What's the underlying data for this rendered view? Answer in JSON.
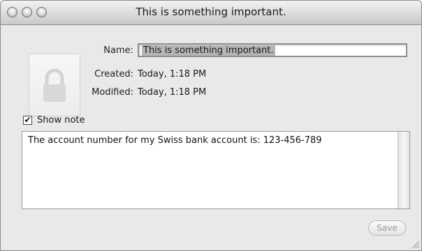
{
  "window": {
    "title": "This is something important."
  },
  "info": {
    "name_label": "Name:",
    "name_value": "This is something important.",
    "created_label": "Created:",
    "created_value": "Today, 1:18 PM",
    "modified_label": "Modified:",
    "modified_value": "Today, 1:18 PM"
  },
  "note": {
    "show_note_label": "Show note",
    "show_note_checked": true,
    "text": "The account number for my Swiss bank account is: 123-456-789"
  },
  "footer": {
    "save_label": "Save"
  },
  "icons": {
    "lock": "lock-icon",
    "checkmark": "checkmark-icon",
    "resize": "resize-grip-icon"
  }
}
